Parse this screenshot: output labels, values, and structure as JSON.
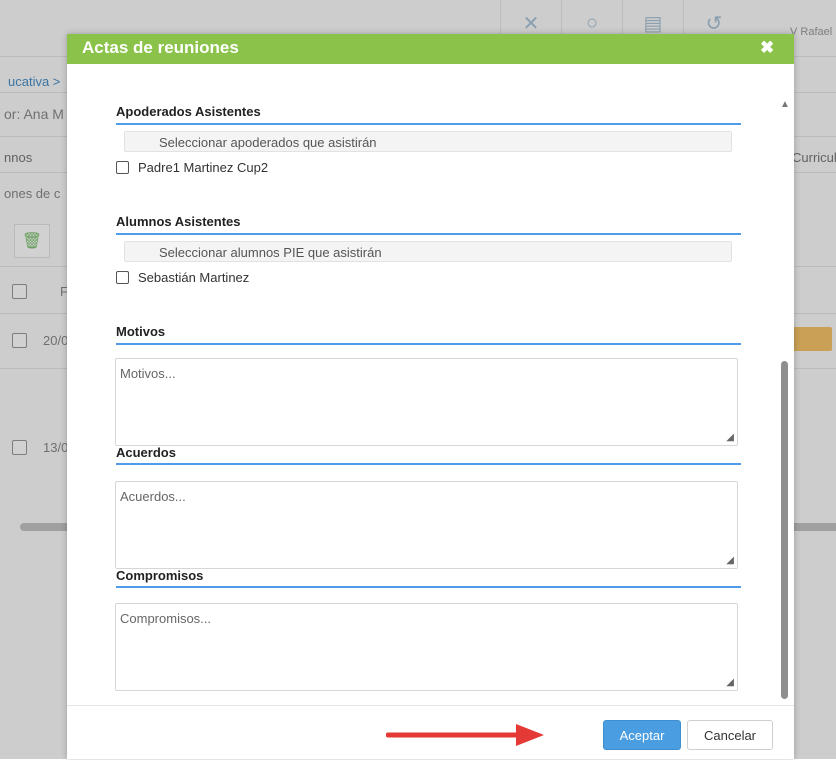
{
  "background": {
    "toolbar_icons": [
      "tools-icon",
      "search-icon",
      "document-icon",
      "history-icon"
    ],
    "user": "V Rafael",
    "breadcrumb": "ucativa >",
    "professor": "or: Ana M",
    "tab_left": "nnos",
    "tab_right": "Curricul",
    "subsection": "ones de c",
    "rows": [
      {
        "date": "20/0"
      },
      {
        "date": "13/0"
      }
    ],
    "header_col": "F"
  },
  "modal": {
    "title": "Actas de reuniones",
    "close_symbol": "✖",
    "apoderados": {
      "title": "Apoderados Asistentes",
      "select_placeholder": "Seleccionar apoderados que asistirán",
      "options": [
        {
          "label": "Padre1 Martinez Cup2",
          "checked": false
        }
      ]
    },
    "alumnos": {
      "title": "Alumnos Asistentes",
      "select_placeholder": "Seleccionar alumnos PIE que asistirán",
      "options": [
        {
          "label": "Sebastián Martinez",
          "checked": false
        }
      ]
    },
    "motivos": {
      "title": "Motivos",
      "placeholder": "Motivos..."
    },
    "acuerdos": {
      "title": "Acuerdos",
      "placeholder": "Acuerdos..."
    },
    "compromisos": {
      "title": "Compromisos",
      "placeholder": "Compromisos..."
    },
    "footer": {
      "accept_label": "Aceptar",
      "cancel_label": "Cancelar"
    }
  },
  "colors": {
    "header": "#8bc34a",
    "accent_line": "#4f9de8",
    "accept_button": "#4a9de0",
    "arrow": "#e53935"
  }
}
